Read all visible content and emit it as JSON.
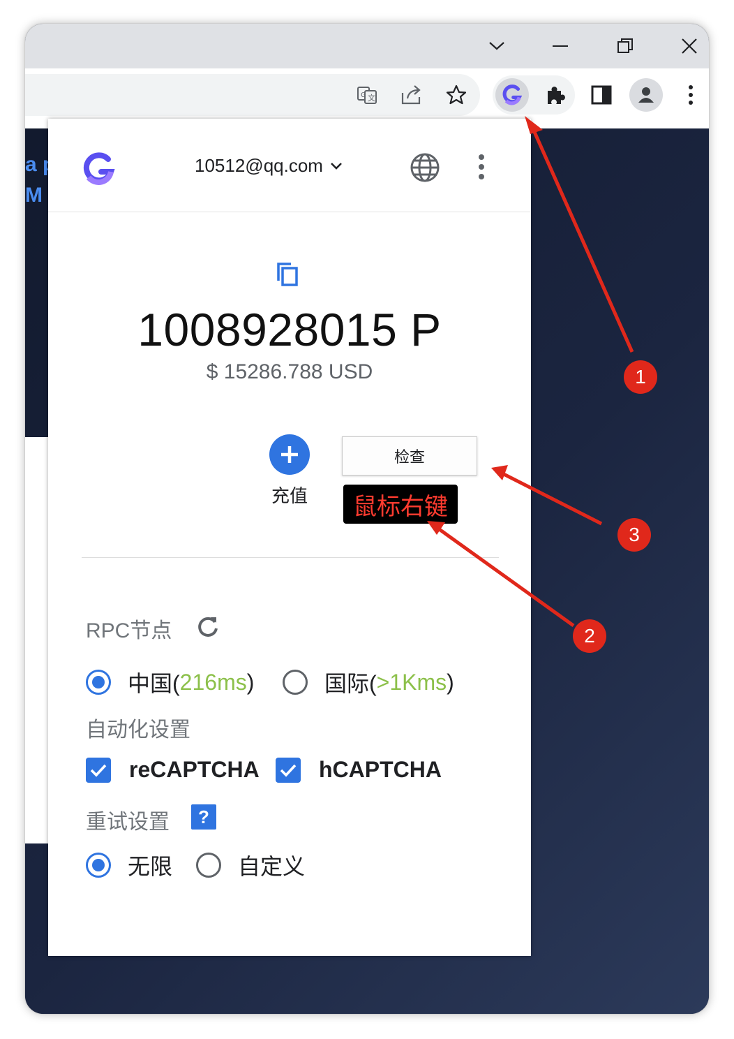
{
  "browser": {
    "window_controls": [
      "chevron-down",
      "minimize",
      "restore",
      "close"
    ]
  },
  "page": {
    "side_text_line1": "a p",
    "side_text_line2": "M"
  },
  "popup": {
    "account_email": "10512@qq.com",
    "balance": "1008928015 P",
    "usd": "$ 15286.788 USD",
    "recharge_label": "充值",
    "context_menu_item": "检查",
    "rpc_label": "RPC节点",
    "rpc_options": [
      {
        "name": "中国(",
        "latency": "216ms",
        "close": ")",
        "selected": true
      },
      {
        "name": "国际(",
        "latency": ">1Kms",
        "close": ")",
        "selected": false
      }
    ],
    "auto_label": "自动化设置",
    "captcha_options": [
      {
        "label": "reCAPTCHA",
        "checked": true
      },
      {
        "label": "hCAPTCHA",
        "checked": true
      }
    ],
    "retry_label": "重试设置",
    "help_mark": "?",
    "retry_options": [
      {
        "label": "无限",
        "selected": true
      },
      {
        "label": "自定义",
        "selected": false
      }
    ]
  },
  "annotations": {
    "right_click_label": "鼠标右键",
    "badges": [
      "1",
      "2",
      "3"
    ]
  },
  "colors": {
    "accent_blue": "#2f74e0",
    "latency_green": "#8cc04a",
    "annotation_red": "#e0281b",
    "logo_purple": "#5a4ff0"
  }
}
